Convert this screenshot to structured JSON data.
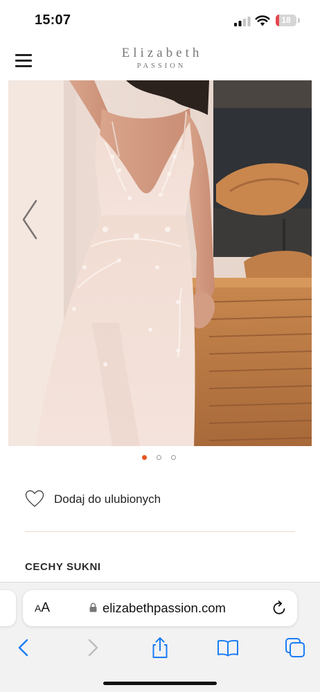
{
  "status_bar": {
    "time": "15:07",
    "battery": {
      "level": "18",
      "level_fraction": 0.18,
      "color": "#e5484d"
    },
    "icons": [
      "cellular-signal-icon",
      "wifi-icon",
      "battery-icon"
    ]
  },
  "header": {
    "brand_main": "Elizabeth",
    "brand_sub": "PASSION",
    "menu_icon": "hamburger-menu-icon"
  },
  "gallery": {
    "prev_icon": "chevron-left-icon",
    "slide_count": 3,
    "active_slide": 1,
    "active_dot_color": "#e8541f",
    "inactive_dot_color": "#9a9a9a"
  },
  "product": {
    "favorite_label": "Dodaj do ulubionych",
    "favorite_icon": "heart-outline-icon",
    "section_title": "CECHY SUKNI",
    "divider_color": "#f0d9c6"
  },
  "browser": {
    "text_size_label_big": "A",
    "text_size_label_small": "A",
    "url": "elizabethpassion.com",
    "accent_color": "#1a7cf5",
    "toolbar": [
      {
        "name": "back-button",
        "icon": "chevron-left-icon",
        "enabled": true
      },
      {
        "name": "forward-button",
        "icon": "chevron-right-icon",
        "enabled": false
      },
      {
        "name": "share-button",
        "icon": "share-icon",
        "enabled": true
      },
      {
        "name": "bookmarks-button",
        "icon": "book-icon",
        "enabled": true
      },
      {
        "name": "tabs-button",
        "icon": "tabs-icon",
        "enabled": true
      }
    ]
  }
}
